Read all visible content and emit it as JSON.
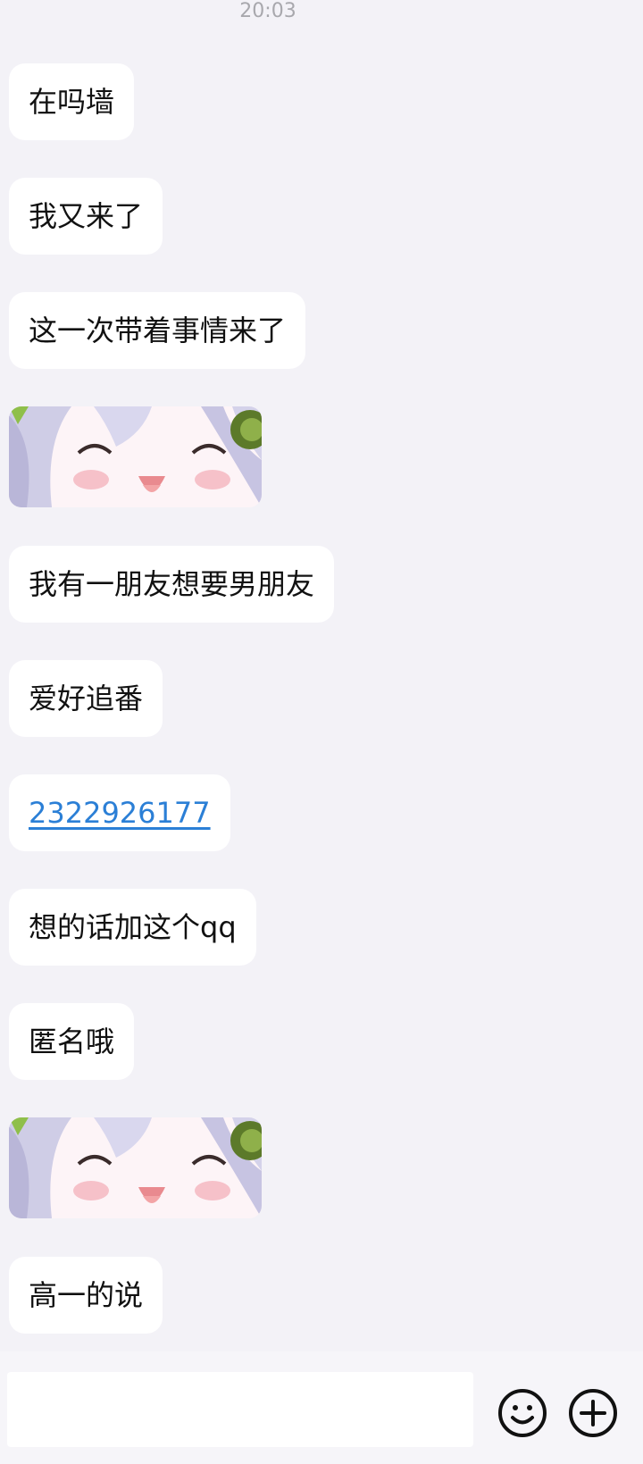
{
  "status": {
    "time": "20:03"
  },
  "messages": [
    {
      "text": "在吗墙"
    },
    {
      "text": "我又来了"
    },
    {
      "text": "这一次带着事情来了"
    },
    {
      "text": "我有一朋友想要男朋友"
    },
    {
      "text": "爱好追番"
    },
    {
      "text": "2322926177"
    },
    {
      "text": "想的话加这个qq"
    },
    {
      "text": "匿名哦"
    },
    {
      "text": "高一的说"
    }
  ],
  "stickers": [
    {
      "name": "smiling-anime-girl-sticker"
    },
    {
      "name": "smiling-anime-girl-sticker"
    }
  ],
  "composer": {
    "input_value": "",
    "emoji_icon": "smiley-face-icon",
    "plus_icon": "plus-circle-icon"
  },
  "colors": {
    "background": "#f3f2f7",
    "bubble": "#ffffff",
    "link": "#2b7fd6"
  }
}
